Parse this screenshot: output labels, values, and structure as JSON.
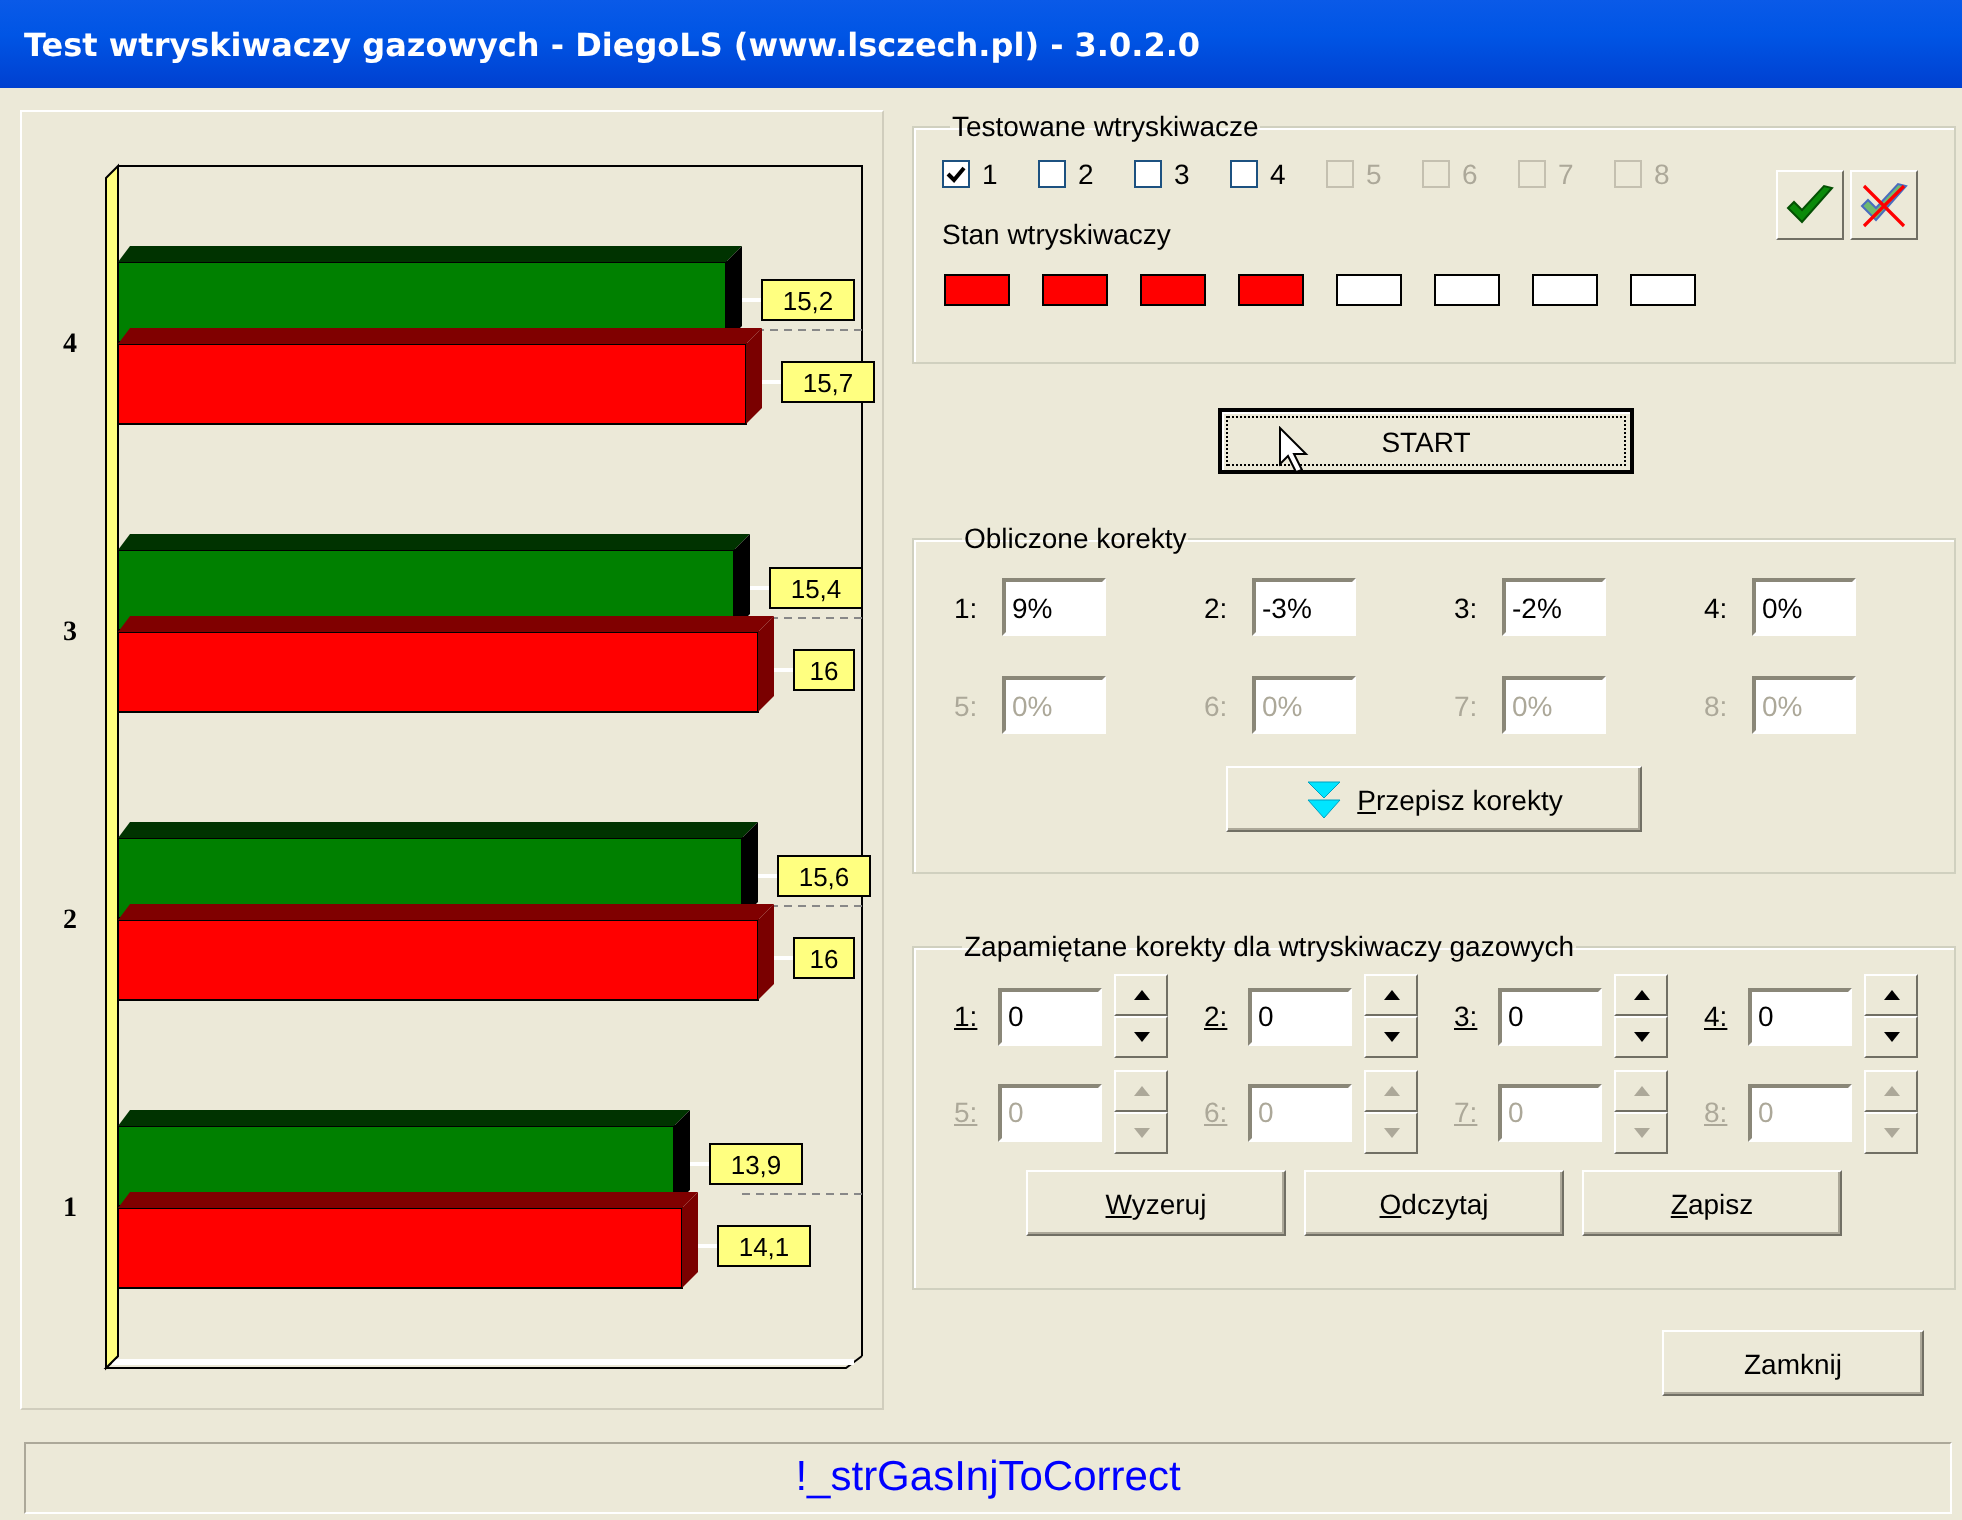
{
  "window": {
    "title": "Test wtryskiwaczy gazowych - DiegoLS (www.lsczech.pl) - 3.0.2.0"
  },
  "chart": {
    "chart_data": {
      "type": "bar",
      "orientation": "horizontal",
      "categories": [
        "4",
        "3",
        "2",
        "1"
      ],
      "data_labels": true,
      "series": [
        {
          "color": "#008000",
          "values": [
            15.2,
            15.4,
            15.6,
            13.9
          ],
          "value_labels": [
            "15,2",
            "15,4",
            "15,6",
            "13,9"
          ]
        },
        {
          "color": "#ff0000",
          "values": [
            15.7,
            16,
            16,
            14.1
          ],
          "value_labels": [
            "15,7",
            "16",
            "16",
            "14,1"
          ]
        }
      ]
    }
  },
  "tested_injectors": {
    "title": "Testowane wtryskiwacze",
    "items": [
      {
        "label": "1",
        "checked": true,
        "disabled": false
      },
      {
        "label": "2",
        "checked": false,
        "disabled": false
      },
      {
        "label": "3",
        "checked": false,
        "disabled": false
      },
      {
        "label": "4",
        "checked": false,
        "disabled": false
      },
      {
        "label": "5",
        "checked": false,
        "disabled": true
      },
      {
        "label": "6",
        "checked": false,
        "disabled": true
      },
      {
        "label": "7",
        "checked": false,
        "disabled": true
      },
      {
        "label": "8",
        "checked": false,
        "disabled": true
      }
    ],
    "state_title": "Stan wtryskiwaczy",
    "states": [
      {
        "color": "#ff0000"
      },
      {
        "color": "#ff0000"
      },
      {
        "color": "#ff0000"
      },
      {
        "color": "#ff0000"
      },
      {
        "color": "#ffffff"
      },
      {
        "color": "#ffffff"
      },
      {
        "color": "#ffffff"
      },
      {
        "color": "#ffffff"
      }
    ]
  },
  "start_button": "START",
  "computed": {
    "title": "Obliczone korekty",
    "fields": [
      {
        "label": "1:",
        "value": "9%",
        "disabled": false
      },
      {
        "label": "2:",
        "value": "-3%",
        "disabled": false
      },
      {
        "label": "3:",
        "value": "-2%",
        "disabled": false
      },
      {
        "label": "4:",
        "value": "0%",
        "disabled": false
      },
      {
        "label": "5:",
        "value": "0%",
        "disabled": true
      },
      {
        "label": "6:",
        "value": "0%",
        "disabled": true
      },
      {
        "label": "7:",
        "value": "0%",
        "disabled": true
      },
      {
        "label": "8:",
        "value": "0%",
        "disabled": true
      }
    ],
    "copy_button": "Przepisz korekty"
  },
  "stored": {
    "title": "Zapamiętane korekty dla wtryskiwaczy gazowych",
    "fields": [
      {
        "label": "1:",
        "value": "0",
        "disabled": false
      },
      {
        "label": "2:",
        "value": "0",
        "disabled": false
      },
      {
        "label": "3:",
        "value": "0",
        "disabled": false
      },
      {
        "label": "4:",
        "value": "0",
        "disabled": false
      },
      {
        "label": "5:",
        "value": "0",
        "disabled": true
      },
      {
        "label": "6:",
        "value": "0",
        "disabled": true
      },
      {
        "label": "7:",
        "value": "0",
        "disabled": true
      },
      {
        "label": "8:",
        "value": "0",
        "disabled": true
      }
    ],
    "buttons": [
      "Wyzeruj",
      "Odczytaj",
      "Zapisz"
    ]
  },
  "close_button": "Zamknij",
  "status_bar": "!_strGasInjToCorrect"
}
